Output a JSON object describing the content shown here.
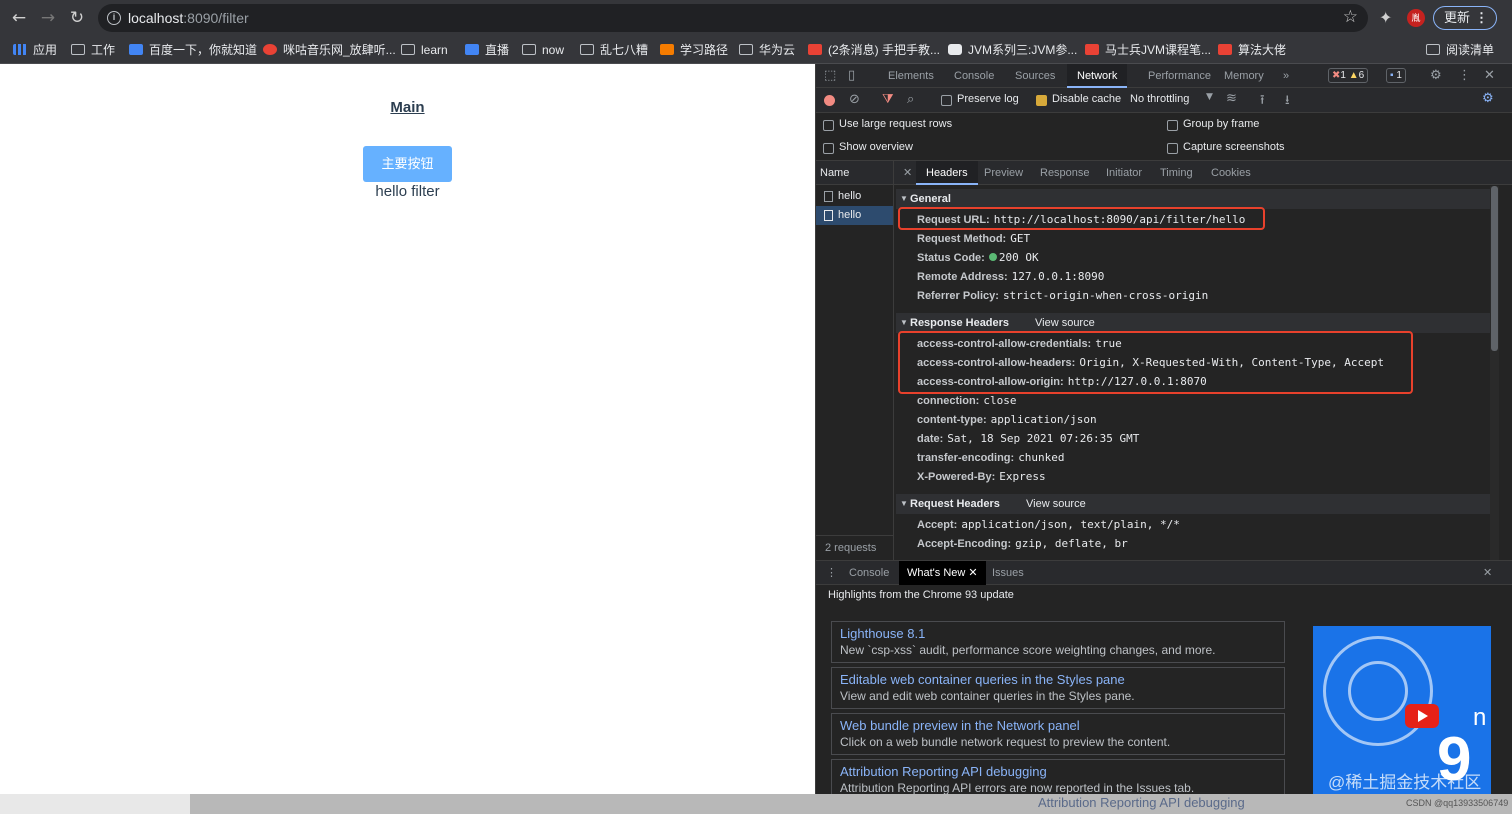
{
  "browser": {
    "url_host": "localhost",
    "url_rest": ":8090/filter",
    "update_label": "更新",
    "profile_initial": "胤"
  },
  "bookmarks": [
    {
      "label": "应用",
      "icon": "apps-grid-icon"
    },
    {
      "label": "工作",
      "icon": "folder-icon"
    },
    {
      "label": "百度一下，你就知道",
      "icon": "baidu-icon"
    },
    {
      "label": "咪咕音乐网_放肆听...",
      "icon": "migu-icon"
    },
    {
      "label": "learn",
      "icon": "folder-icon"
    },
    {
      "label": "直播",
      "icon": "bilibili-icon"
    },
    {
      "label": "now",
      "icon": "folder-icon"
    },
    {
      "label": "乱七八糟",
      "icon": "folder-icon"
    },
    {
      "label": "学习路径",
      "icon": "site-icon"
    },
    {
      "label": "华为云",
      "icon": "folder-icon"
    },
    {
      "label": "(2条消息) 手把手教...",
      "icon": "csdn-icon"
    },
    {
      "label": "JVM系列三:JVM参...",
      "icon": "site-icon"
    },
    {
      "label": "马士兵JVM课程笔...",
      "icon": "site-icon"
    },
    {
      "label": "算法大佬",
      "icon": "51-icon"
    },
    {
      "label": "阅读清单",
      "icon": "reading-list-icon"
    }
  ],
  "page": {
    "main_link": "Main",
    "primary_button": "主要按钮",
    "hello_text": "hello filter"
  },
  "devtools": {
    "tabs": [
      "Elements",
      "Console",
      "Sources",
      "Network",
      "Performance",
      "Memory"
    ],
    "active_tab": "Network",
    "errors": "1",
    "warnings": "6",
    "messages": "1",
    "toolbar": {
      "preserve_log": "Preserve log",
      "disable_cache": "Disable cache",
      "throttling": "No throttling"
    },
    "options": {
      "large_rows": "Use large request rows",
      "group_by_frame": "Group by frame",
      "show_overview": "Show overview",
      "capture_screenshots": "Capture screenshots"
    },
    "request_list": {
      "header": "Name",
      "rows": [
        "hello",
        "hello"
      ],
      "footer": "2 requests"
    },
    "detail_tabs": [
      "Headers",
      "Preview",
      "Response",
      "Initiator",
      "Timing",
      "Cookies"
    ],
    "general": {
      "title": "General",
      "rows": [
        {
          "k": "Request URL:",
          "v": "http://localhost:8090/api/filter/hello"
        },
        {
          "k": "Request Method:",
          "v": "GET"
        },
        {
          "k": "Status Code:",
          "v": "200 OK"
        },
        {
          "k": "Remote Address:",
          "v": "127.0.0.1:8090"
        },
        {
          "k": "Referrer Policy:",
          "v": "strict-origin-when-cross-origin"
        }
      ]
    },
    "response_headers": {
      "title": "Response Headers",
      "view_source": "View source",
      "rows": [
        {
          "k": "access-control-allow-credentials:",
          "v": "true"
        },
        {
          "k": "access-control-allow-headers:",
          "v": "Origin, X-Requested-With, Content-Type, Accept"
        },
        {
          "k": "access-control-allow-origin:",
          "v": "http://127.0.0.1:8070"
        },
        {
          "k": "connection:",
          "v": "close"
        },
        {
          "k": "content-type:",
          "v": "application/json"
        },
        {
          "k": "date:",
          "v": "Sat, 18 Sep 2021 07:26:35 GMT"
        },
        {
          "k": "transfer-encoding:",
          "v": "chunked"
        },
        {
          "k": "X-Powered-By:",
          "v": "Express"
        }
      ]
    },
    "request_headers": {
      "title": "Request Headers",
      "view_source": "View source",
      "rows": [
        {
          "k": "Accept:",
          "v": "application/json, text/plain, */*"
        },
        {
          "k": "Accept-Encoding:",
          "v": "gzip, deflate, br"
        }
      ]
    },
    "drawer": {
      "tabs": [
        "Console",
        "What's New",
        "Issues"
      ],
      "active_tab": "What's New",
      "heading": "Highlights from the Chrome 93 update",
      "cards": [
        {
          "title": "Lighthouse 8.1",
          "desc": "New `csp-xss` audit, performance score weighting changes, and more."
        },
        {
          "title": "Editable web container queries in the Styles pane",
          "desc": "View and edit web container queries in the Styles pane."
        },
        {
          "title": "Web bundle preview in the Network panel",
          "desc": "Click on a web bundle network request to preview the content."
        },
        {
          "title": "Attribution Reporting API debugging",
          "desc": "Attribution Reporting API errors are now reported in the Issues tab."
        }
      ]
    }
  },
  "bottom_strip_text": "Attribution Reporting API debugging",
  "watermark": "@稀土掘金技术社区",
  "csdn_mark": "CSDN @qq13933506749"
}
